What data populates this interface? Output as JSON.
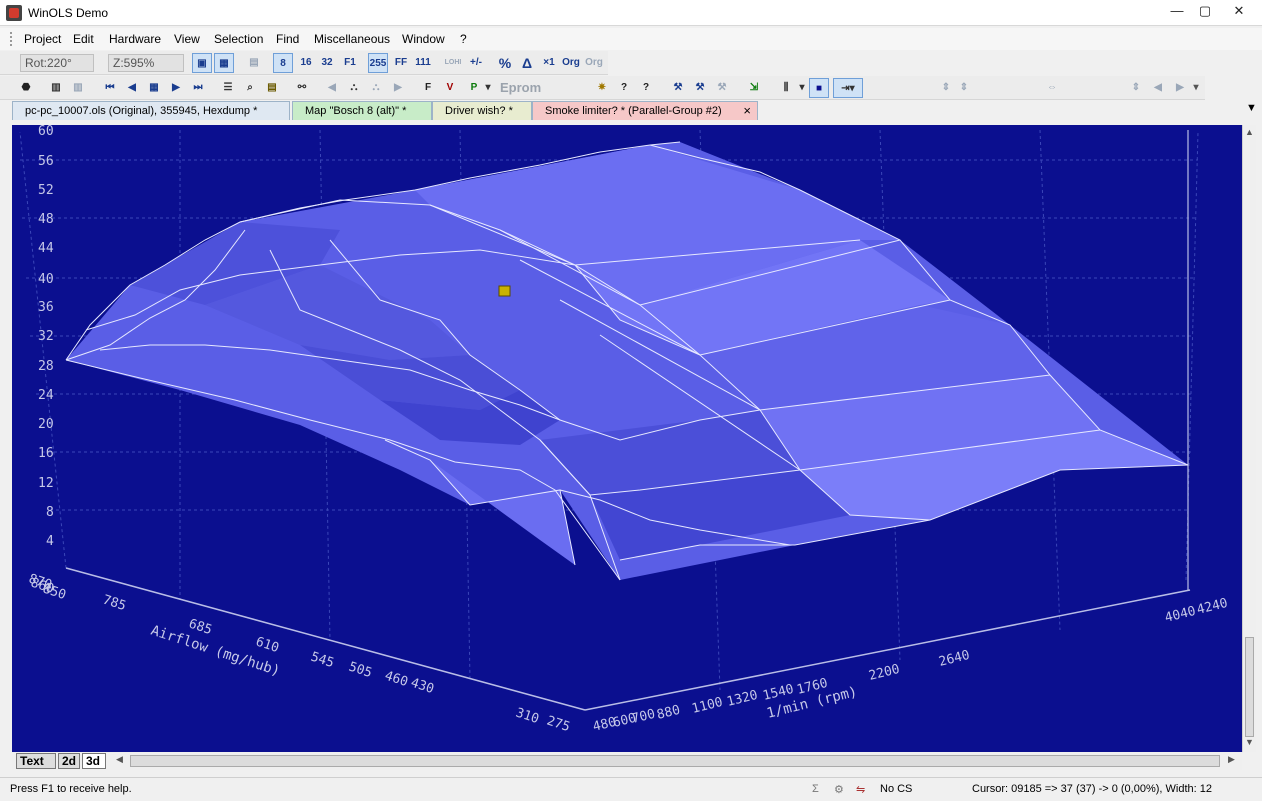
{
  "window": {
    "title": "WinOLS Demo",
    "minimize": "—",
    "maximize": "▢",
    "close": "✕"
  },
  "menu": [
    "Project",
    "Edit",
    "Hardware",
    "View",
    "Selection",
    "Find",
    "Miscellaneous",
    "Window",
    "?"
  ],
  "toolbar1": {
    "rot": "Rot:220°",
    "zoom": "Z:595%",
    "btn_8": "8",
    "btn_16": "16",
    "btn_32": "32",
    "btn_f1": "F1",
    "btn_255": "255",
    "btn_ff": "FF",
    "btn_111": "111",
    "btn_lohi": "LOHI",
    "btn_percent": "%",
    "btn_delta": "Δ",
    "btn_x1": "×1",
    "btn_org": "Org",
    "btn_org2": "Org"
  },
  "toolbar2": {
    "eprom_label": "Eprom"
  },
  "tabs": [
    {
      "label": "pc-pc_10007.ols (Original), 355945, Hexdump *",
      "color": "#dfe8f2"
    },
    {
      "label": "Map \"Bosch  8 (alt)\" *",
      "color": "#c8ecc8"
    },
    {
      "label": "Driver wish? *",
      "color": "#e8ecd0"
    },
    {
      "label": "Smoke limiter? * (Parallel-Group #2)",
      "color": "#f6c8c8"
    }
  ],
  "tab_close": "×",
  "chart": {
    "z_ticks": [
      "60",
      "56",
      "52",
      "48",
      "44",
      "40",
      "36",
      "32",
      "28",
      "24",
      "20",
      "16",
      "12",
      "8",
      "4"
    ],
    "airflow_label": "Airflow (mg/hub)",
    "airflow_ticks": [
      "870",
      "860",
      "850",
      "785",
      "685",
      "610",
      "545",
      "505",
      "460",
      "430",
      "310",
      "275"
    ],
    "rpm_label": "1/min (rpm)",
    "rpm_ticks": [
      "480",
      "600",
      "700",
      "880",
      "1100",
      "1320",
      "1540",
      "1760",
      "2200",
      "2640",
      "4040",
      "4240"
    ],
    "colors": {
      "background": "#0b0f8f",
      "surface_light": "#7073f4",
      "surface_mid": "#5a5ee6",
      "surface_dark": "#3f43cf",
      "cursor": "#c9b200"
    }
  },
  "view_tabs": [
    "Text",
    "2d",
    "3d"
  ],
  "status": {
    "help": "Press F1 to receive help.",
    "checksum": "No CS",
    "cursor": "Cursor: 09185 =>  37 (37) ->   0 (0,00%), Width: 12"
  }
}
